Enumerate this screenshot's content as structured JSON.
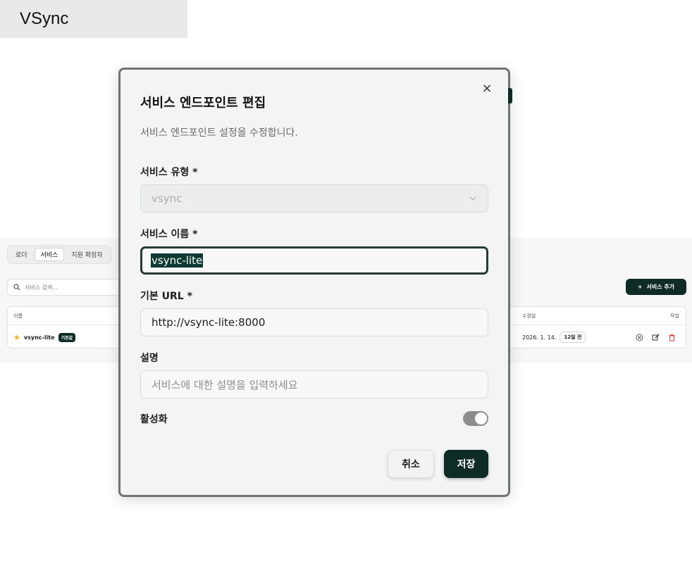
{
  "app": {
    "title": "VSync"
  },
  "background": {
    "tabs": [
      {
        "label": "로더",
        "active": false
      },
      {
        "label": "서비스",
        "active": true
      },
      {
        "label": "지원 확장자",
        "active": false
      }
    ],
    "search": {
      "placeholder": "서비스 검색..."
    },
    "add_button": {
      "label": "서비스 추가"
    },
    "table": {
      "columns": {
        "name": "이름",
        "modified": "수정일",
        "actions": "작업"
      },
      "rows": [
        {
          "name": "vsync-lite",
          "badge": "기본값",
          "date": "2026. 1. 14.",
          "relative": "12일 전"
        }
      ]
    }
  },
  "modal": {
    "title": "서비스 엔드포인트 편집",
    "description": "서비스 엔드포인트 설정을 수정합니다.",
    "fields": {
      "type": {
        "label": "서비스 유형 *",
        "value": "vsync"
      },
      "name": {
        "label": "서비스 이름 *",
        "value": "vsync-lite"
      },
      "url": {
        "label": "기본 URL *",
        "value": "http://vsync-lite:8000"
      },
      "description": {
        "label": "설명",
        "placeholder": "서비스에 대한 설명을 입력하세요"
      },
      "active": {
        "label": "활성화",
        "enabled": true
      }
    },
    "buttons": {
      "cancel": "취소",
      "save": "저장"
    }
  },
  "colors": {
    "primary": "#0f2b26",
    "star": "#f0b429",
    "danger": "#d93b3b"
  }
}
